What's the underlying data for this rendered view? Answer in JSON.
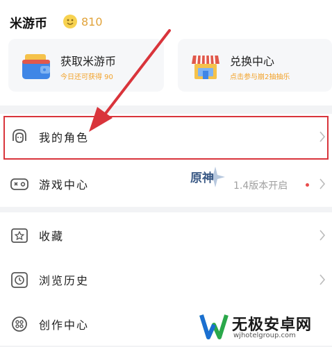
{
  "coins": {
    "title": "米游币",
    "count": "810"
  },
  "cards": {
    "earn": {
      "title": "获取米游币",
      "subtitle": "今日还可获得 90"
    },
    "exchange": {
      "title": "兑换中心",
      "subtitle": "点击参与崩2抽抽乐"
    }
  },
  "menu": {
    "my_roles": "我的角色",
    "game_center": "游戏中心",
    "game_center_promo": "1.4版本开启",
    "favorites": "收藏",
    "history": "浏览历史",
    "creator_center": "创作中心"
  },
  "game_logo_text": "原神",
  "watermark": {
    "brand": "无极安卓网",
    "url": "wjhotelgroup.com"
  },
  "colors": {
    "accent_orange": "#f2a229",
    "highlight_red": "#d9343b",
    "red_dot": "#e84b4b"
  },
  "icons": {
    "coin": "coin-icon",
    "wallet": "wallet-icon",
    "shop": "shop-icon",
    "role": "role-icon",
    "gamepad": "gamepad-icon",
    "star": "star-icon",
    "clock": "clock-icon",
    "creator": "creator-icon",
    "chevron": "chevron-right-icon"
  }
}
